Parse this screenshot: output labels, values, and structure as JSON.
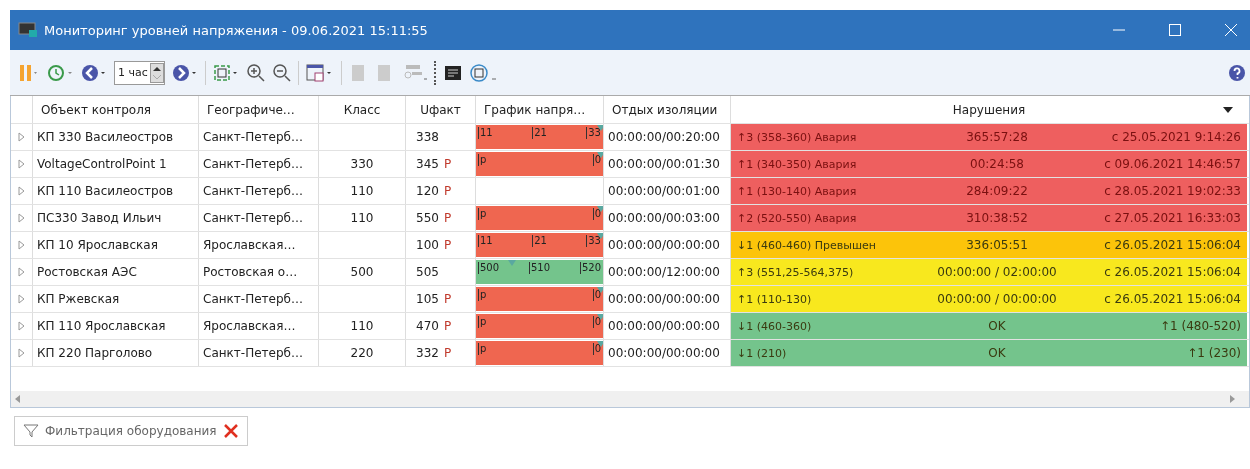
{
  "window": {
    "title": "Мониторинг уровней напряжения - 09.06.2021 15:11:55"
  },
  "toolbar": {
    "period": "1 час"
  },
  "table": {
    "columns": [
      "Объект контроля",
      "Географиче…",
      "Класс",
      "Uфакт",
      "График напря…",
      "Отдых изоляции",
      "Нарушения"
    ],
    "rows": [
      {
        "name": "КП 330 Василеостров",
        "geo": "Санкт-Петерб…",
        "class": "",
        "ufact": "338",
        "flag": "",
        "chart": {
          "kind": "scale",
          "labels": [
            "11",
            "21",
            "33"
          ],
          "color": "#ef6650",
          "level": 1
        },
        "rest": "00:00:00/00:20:00",
        "violation": {
          "text": "↑3 (358-360) Авария",
          "duration": "365:57:28",
          "since": "с 25.05.2021 9:14:26",
          "color": "#ee5f5f"
        }
      },
      {
        "name": "VoltageControlPoint 1",
        "geo": "Санкт-Петерб…",
        "class": "330",
        "ufact": "345",
        "flag": "P",
        "chart": {
          "kind": "scale",
          "labels": [
            "p",
            "0"
          ],
          "color": "#ef6650",
          "level": 1
        },
        "rest": "00:00:00/00:01:30",
        "violation": {
          "text": "↑1 (340-350) Авария",
          "duration": "00:24:58",
          "since": "с 09.06.2021 14:46:57",
          "color": "#ee5f5f"
        }
      },
      {
        "name": "КП 110 Василеостров",
        "geo": "Санкт-Петерб…",
        "class": "110",
        "ufact": "120",
        "flag": "P",
        "chart": {
          "kind": "empty"
        },
        "rest": "00:00:00/00:01:00",
        "violation": {
          "text": "↑1 (130-140) Авария",
          "duration": "284:09:22",
          "since": "с 28.05.2021 19:02:33",
          "color": "#ee5f5f"
        }
      },
      {
        "name": "ПС330 Завод Ильич",
        "geo": "Санкт-Петерб…",
        "class": "110",
        "ufact": "550",
        "flag": "P",
        "chart": {
          "kind": "scale",
          "labels": [
            "p",
            "0"
          ],
          "color": "#ef6650",
          "level": 1
        },
        "rest": "00:00:00/00:03:00",
        "violation": {
          "text": "↑2 (520-550) Авария",
          "duration": "310:38:52",
          "since": "с 27.05.2021 16:33:03",
          "color": "#ee5f5f"
        }
      },
      {
        "name": "КП 10 Ярославская",
        "geo": "Ярославская…",
        "class": "",
        "ufact": "100",
        "flag": "P",
        "chart": {
          "kind": "scale",
          "labels": [
            "11",
            "21",
            "33"
          ],
          "color": "#ef6650",
          "level": 1
        },
        "rest": "00:00:00/00:00:00",
        "violation": {
          "text": "↓1 (460-460) Превышен",
          "duration": "336:05:51",
          "since": "с 26.05.2021 15:06:04",
          "color": "#fcc40a"
        }
      },
      {
        "name": "Ростовская АЭС",
        "geo": "Ростовская о…",
        "class": "500",
        "ufact": "505",
        "flag": "",
        "chart": {
          "kind": "scale",
          "labels": [
            "500",
            "510",
            "520"
          ],
          "color": "#74c48c",
          "level": 0.3
        },
        "rest": "00:00:00/12:00:00",
        "violation": {
          "text": "↑3 (551,25-564,375)",
          "duration": "00:00:00 / 02:00:00",
          "since": "с 26.05.2021 15:06:04",
          "color": "#f8e81e"
        }
      },
      {
        "name": "КП Ржевская",
        "geo": "Санкт-Петерб…",
        "class": "",
        "ufact": "105",
        "flag": "P",
        "chart": {
          "kind": "scale",
          "labels": [
            "p",
            "0"
          ],
          "color": "#ef6650",
          "level": 1
        },
        "rest": "00:00:00/00:00:00",
        "violation": {
          "text": "↑1 (110-130)",
          "duration": "00:00:00 / 00:00:00",
          "since": "с 26.05.2021 15:06:04",
          "color": "#f8e81e"
        }
      },
      {
        "name": "КП 110 Ярославская",
        "geo": "Ярославская…",
        "class": "110",
        "ufact": "470",
        "flag": "P",
        "chart": {
          "kind": "scale",
          "labels": [
            "p",
            "0"
          ],
          "color": "#ef6650",
          "level": 1
        },
        "rest": "00:00:00/00:00:00",
        "violation": {
          "text": "↓1 (460-360)",
          "duration": "OK",
          "since": "↑1 (480-520)",
          "color": "#74c48c"
        }
      },
      {
        "name": "КП 220 Парголово",
        "geo": "Санкт-Петерб…",
        "class": "220",
        "ufact": "332",
        "flag": "P",
        "chart": {
          "kind": "scale",
          "labels": [
            "p",
            "0"
          ],
          "color": "#ef6650",
          "level": 1
        },
        "rest": "00:00:00/00:00:00",
        "violation": {
          "text": "↓1 (210)",
          "duration": "OK",
          "since": "↑1 (230)",
          "color": "#74c48c"
        }
      }
    ]
  },
  "filter": {
    "label": "Фильтрация оборудования"
  }
}
